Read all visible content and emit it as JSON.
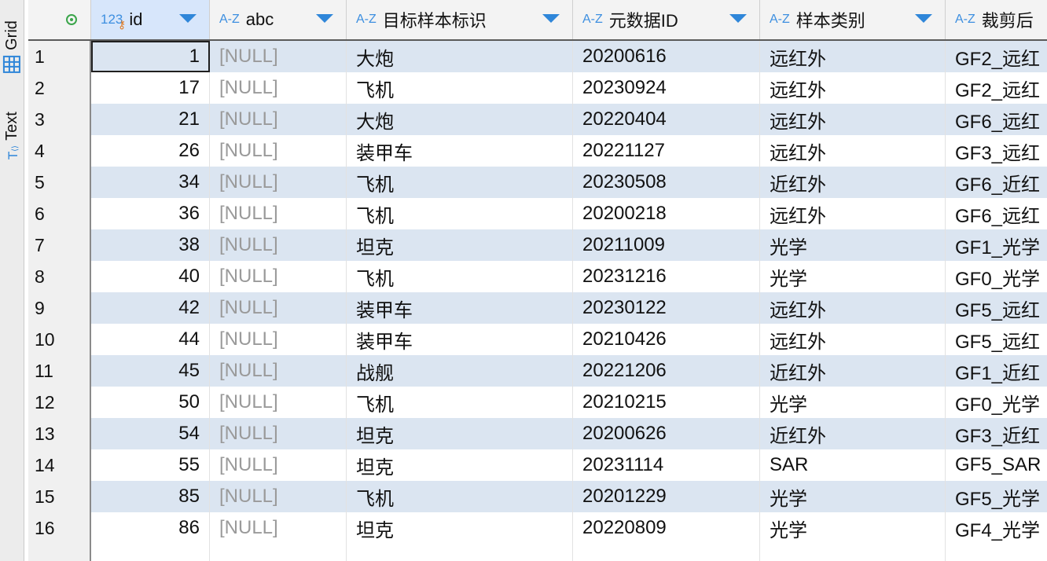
{
  "side_tabs": {
    "grid_label": "Grid",
    "text_label": "Text"
  },
  "columns": [
    {
      "type_label": "123",
      "name": "id"
    },
    {
      "type_label": "A-Z",
      "name": "abc"
    },
    {
      "type_label": "A-Z",
      "name": "目标样本标识"
    },
    {
      "type_label": "A-Z",
      "name": "元数据ID"
    },
    {
      "type_label": "A-Z",
      "name": "样本类别"
    },
    {
      "type_label": "A-Z",
      "name": "裁剪后"
    }
  ],
  "rows": [
    {
      "n": "1",
      "id": "1",
      "abc": "[NULL]",
      "target": "大炮",
      "meta": "20200616",
      "cat": "远红外",
      "crop": "GF2_远红"
    },
    {
      "n": "2",
      "id": "17",
      "abc": "[NULL]",
      "target": "飞机",
      "meta": "20230924",
      "cat": "远红外",
      "crop": "GF2_远红"
    },
    {
      "n": "3",
      "id": "21",
      "abc": "[NULL]",
      "target": "大炮",
      "meta": "20220404",
      "cat": "远红外",
      "crop": "GF6_远红"
    },
    {
      "n": "4",
      "id": "26",
      "abc": "[NULL]",
      "target": "装甲车",
      "meta": "20221127",
      "cat": "远红外",
      "crop": "GF3_远红"
    },
    {
      "n": "5",
      "id": "34",
      "abc": "[NULL]",
      "target": "飞机",
      "meta": "20230508",
      "cat": "近红外",
      "crop": "GF6_近红"
    },
    {
      "n": "6",
      "id": "36",
      "abc": "[NULL]",
      "target": "飞机",
      "meta": "20200218",
      "cat": "远红外",
      "crop": "GF6_远红"
    },
    {
      "n": "7",
      "id": "38",
      "abc": "[NULL]",
      "target": "坦克",
      "meta": "20211009",
      "cat": "光学",
      "crop": "GF1_光学"
    },
    {
      "n": "8",
      "id": "40",
      "abc": "[NULL]",
      "target": "飞机",
      "meta": "20231216",
      "cat": "光学",
      "crop": "GF0_光学"
    },
    {
      "n": "9",
      "id": "42",
      "abc": "[NULL]",
      "target": "装甲车",
      "meta": "20230122",
      "cat": "远红外",
      "crop": "GF5_远红"
    },
    {
      "n": "10",
      "id": "44",
      "abc": "[NULL]",
      "target": "装甲车",
      "meta": "20210426",
      "cat": "远红外",
      "crop": "GF5_远红"
    },
    {
      "n": "11",
      "id": "45",
      "abc": "[NULL]",
      "target": "战舰",
      "meta": "20221206",
      "cat": "近红外",
      "crop": "GF1_近红"
    },
    {
      "n": "12",
      "id": "50",
      "abc": "[NULL]",
      "target": "飞机",
      "meta": "20210215",
      "cat": "光学",
      "crop": "GF0_光学"
    },
    {
      "n": "13",
      "id": "54",
      "abc": "[NULL]",
      "target": "坦克",
      "meta": "20200626",
      "cat": "近红外",
      "crop": "GF3_近红"
    },
    {
      "n": "14",
      "id": "55",
      "abc": "[NULL]",
      "target": "坦克",
      "meta": "20231114",
      "cat": "SAR",
      "crop": "GF5_SAR"
    },
    {
      "n": "15",
      "id": "85",
      "abc": "[NULL]",
      "target": "飞机",
      "meta": "20201229",
      "cat": "光学",
      "crop": "GF5_光学"
    },
    {
      "n": "16",
      "id": "86",
      "abc": "[NULL]",
      "target": "坦克",
      "meta": "20220809",
      "cat": "光学",
      "crop": "GF4_光学"
    }
  ],
  "colors": {
    "accent": "#2f86d9",
    "stripe": "#dbe5f1",
    "null_text": "#9a9a9a",
    "key_icon": "#e0781f",
    "status_dot": "#3aa54a"
  }
}
